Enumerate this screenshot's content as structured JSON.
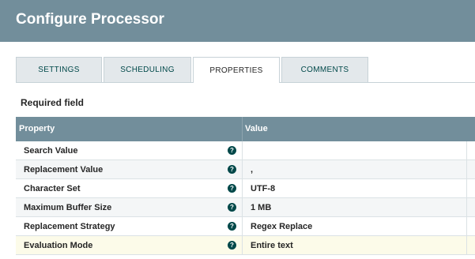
{
  "dialog": {
    "title": "Configure Processor"
  },
  "tabs": [
    {
      "label": "SETTINGS",
      "selected": false
    },
    {
      "label": "SCHEDULING",
      "selected": false
    },
    {
      "label": "PROPERTIES",
      "selected": true
    },
    {
      "label": "COMMENTS",
      "selected": false
    }
  ],
  "required_label": "Required field",
  "grid": {
    "columns": {
      "property": "Property",
      "value": "Value"
    },
    "rows": [
      {
        "name": "Search Value",
        "value": "",
        "help": "?"
      },
      {
        "name": "Replacement Value",
        "value": ",",
        "help": "?"
      },
      {
        "name": "Character Set",
        "value": "UTF-8",
        "help": "?"
      },
      {
        "name": "Maximum Buffer Size",
        "value": "1 MB",
        "help": "?"
      },
      {
        "name": "Replacement Strategy",
        "value": "Regex Replace",
        "help": "?"
      },
      {
        "name": "Evaluation Mode",
        "value": "Entire text",
        "help": "?"
      }
    ]
  },
  "colors": {
    "header": "#728e9b",
    "accent": "#004849",
    "selected_row": "#fcfbe9"
  }
}
